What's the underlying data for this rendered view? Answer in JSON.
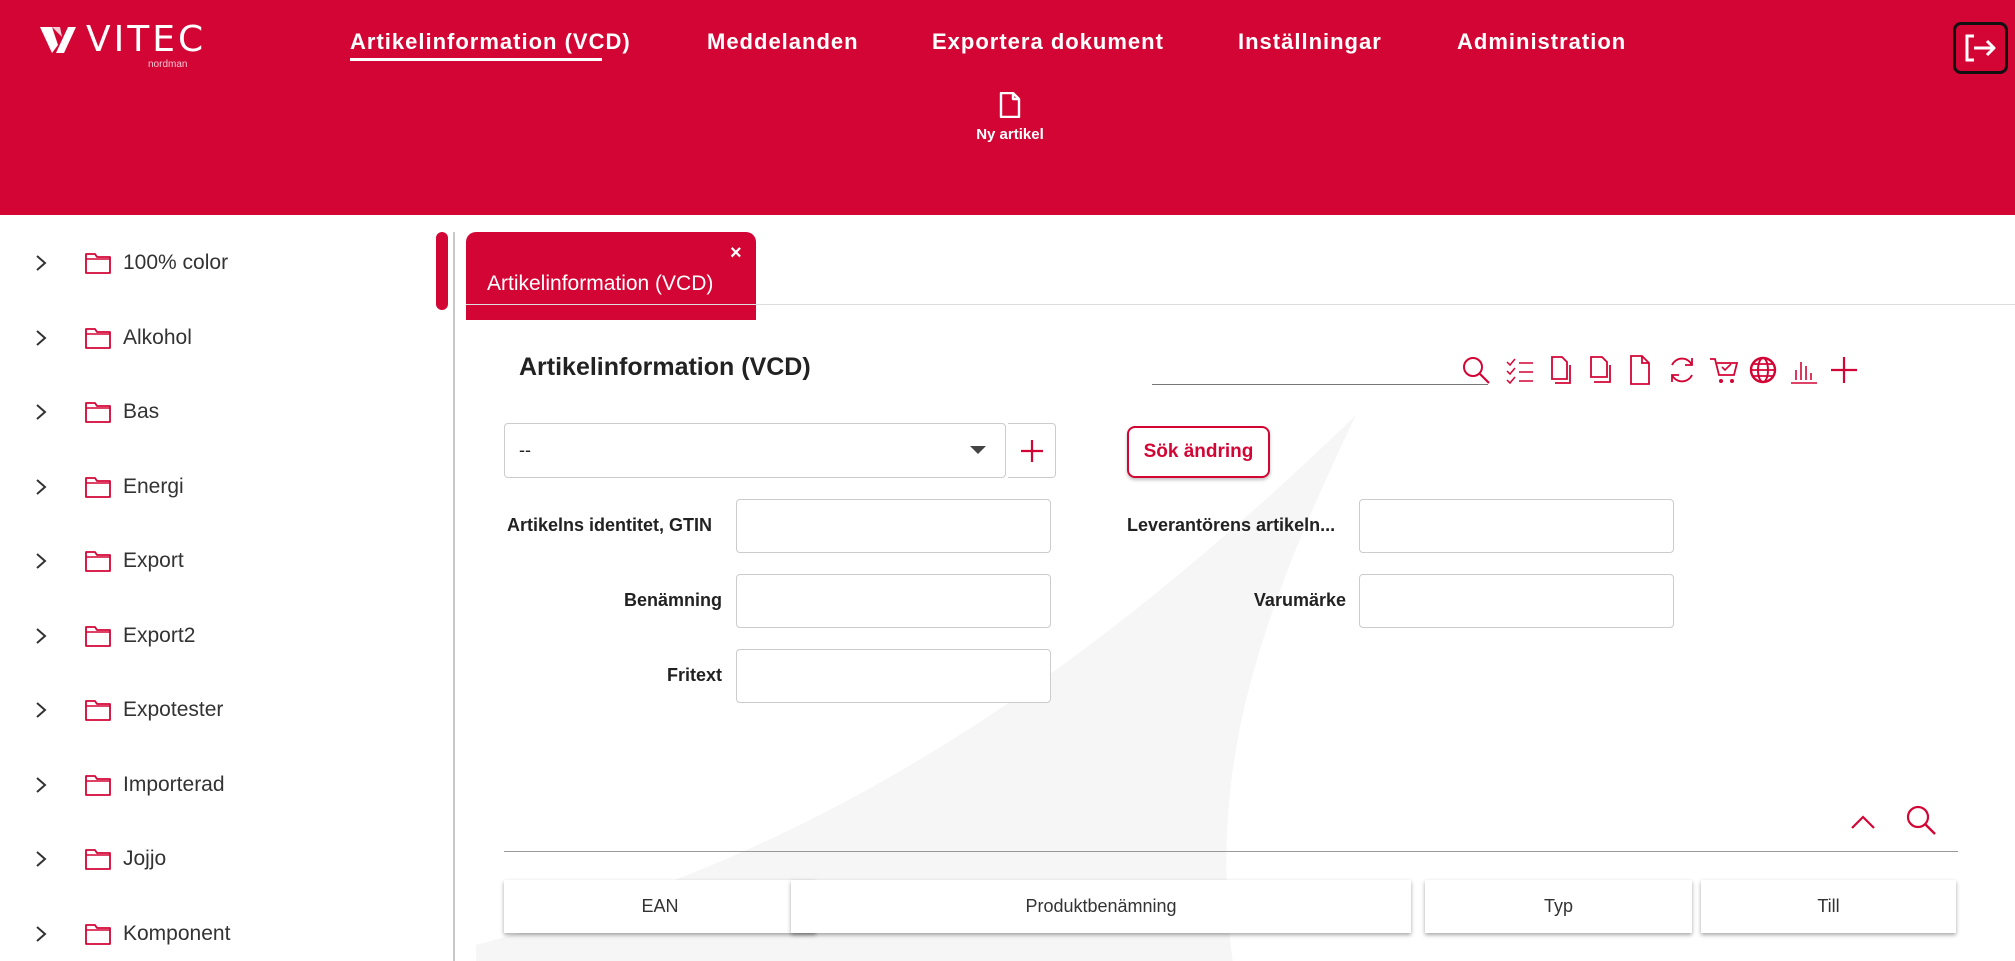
{
  "header": {
    "logo_text": "VITEC",
    "logo_sub": "nordman",
    "nav": [
      {
        "label": "Artikelinformation (VCD)",
        "active": true
      },
      {
        "label": "Meddelanden"
      },
      {
        "label": "Exportera dokument"
      },
      {
        "label": "Inställningar"
      },
      {
        "label": "Administration"
      }
    ],
    "new_item": {
      "label": "Ny artikel",
      "icon": "document-icon"
    },
    "logout_icon": "logout-icon"
  },
  "sidebar": {
    "items": [
      {
        "label": "100% color"
      },
      {
        "label": "Alkohol"
      },
      {
        "label": "Bas"
      },
      {
        "label": "Energi"
      },
      {
        "label": "Export"
      },
      {
        "label": "Export2"
      },
      {
        "label": "Expotester"
      },
      {
        "label": "Importerad"
      },
      {
        "label": "Jojjo"
      },
      {
        "label": "Komponent"
      }
    ]
  },
  "main": {
    "tab": {
      "label": "Artikelinformation (VCD)",
      "close": "×"
    },
    "title": "Artikelinformation (VCD)",
    "toolbar": [
      "search-icon",
      "checklist-icon",
      "copy-icon",
      "copy-alt-icon",
      "document-icon",
      "refresh-icon",
      "cart-icon",
      "globe-icon",
      "chart-icon",
      "add-icon"
    ],
    "select": {
      "value": "--"
    },
    "search_change_button": "Sök ändring",
    "fields": {
      "gtin": {
        "label": "Artikelns identitet, GTIN",
        "value": ""
      },
      "name": {
        "label": "Benämning",
        "value": ""
      },
      "freetext": {
        "label": "Fritext",
        "value": ""
      },
      "supplier_no": {
        "label": "Leverantörens artikeln...",
        "value": ""
      },
      "brand": {
        "label": "Varumärke",
        "value": ""
      }
    },
    "grid": {
      "columns": [
        "EAN",
        "Produktbenämning",
        "Typ",
        "Till"
      ]
    }
  },
  "colors": {
    "brand": "#d30535"
  }
}
